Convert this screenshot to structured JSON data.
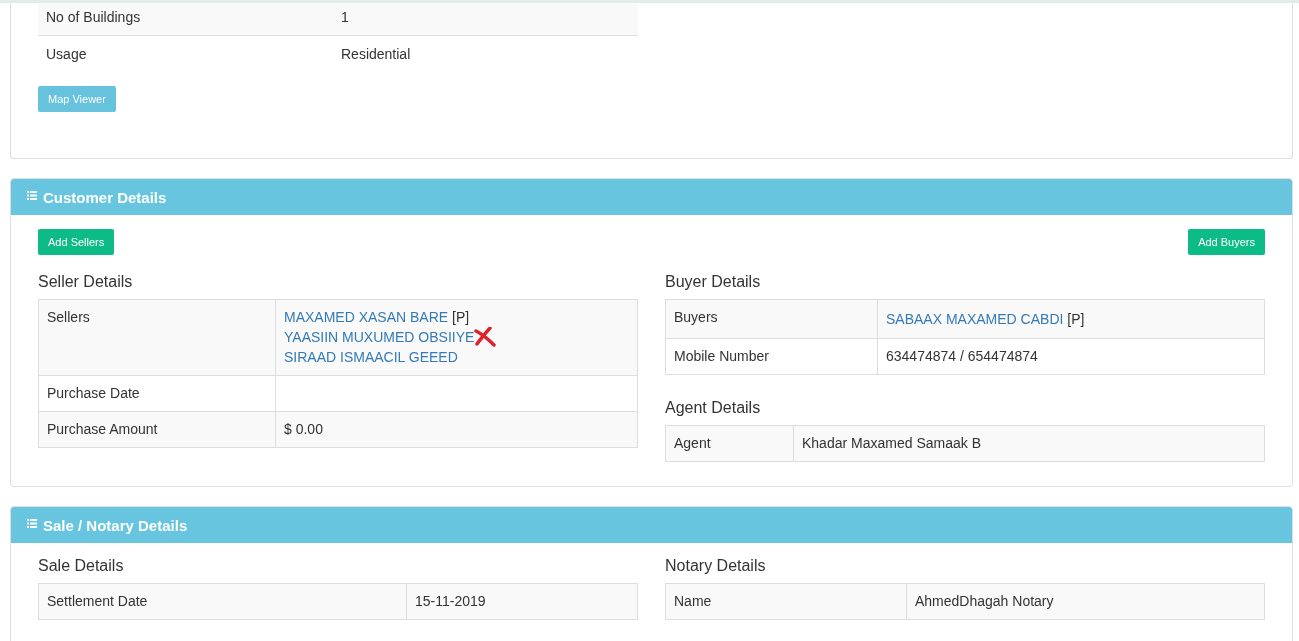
{
  "property_panel": {
    "rows": [
      {
        "label": "No of Buildings",
        "value": "1"
      },
      {
        "label": "Usage",
        "value": "Residential"
      }
    ],
    "map_button": "Map Viewer"
  },
  "customer_panel": {
    "title": "Customer Details",
    "add_sellers": "Add Sellers",
    "add_buyers": "Add Buyers",
    "seller_details": {
      "heading": "Seller Details",
      "sellers_label": "Sellers",
      "sellers": [
        {
          "name": "MAXAMED XASAN BARE",
          "tag": "[P]",
          "crossed": false
        },
        {
          "name": "YAASIIN MUXUMED OBSIIYE",
          "crossed": true
        },
        {
          "name": "SIRAAD ISMAACIL GEEED",
          "crossed": false
        }
      ],
      "rows": [
        {
          "label": "Purchase Date",
          "value": ""
        },
        {
          "label": "Purchase Amount",
          "value": "$ 0.00"
        }
      ]
    },
    "buyer_details": {
      "heading": "Buyer Details",
      "buyers_label": "Buyers",
      "buyers": [
        {
          "name": "SABAAX MAXAMED CABDI",
          "tag": "[P]"
        }
      ],
      "rows": [
        {
          "label": "Mobile Number",
          "value": "634474874 / 654474874"
        }
      ]
    },
    "agent_details": {
      "heading": "Agent Details",
      "rows": [
        {
          "label": "Agent",
          "value": "Khadar Maxamed Samaak B"
        }
      ]
    }
  },
  "sale_panel": {
    "title": "Sale / Notary Details",
    "sale_details": {
      "heading": "Sale Details",
      "rows": [
        {
          "label": "Settlement Date",
          "value": "15-11-2019"
        }
      ]
    },
    "notary_details": {
      "heading": "Notary Details",
      "rows": [
        {
          "label": "Name",
          "value": "AhmedDhagah Notary"
        }
      ]
    }
  }
}
